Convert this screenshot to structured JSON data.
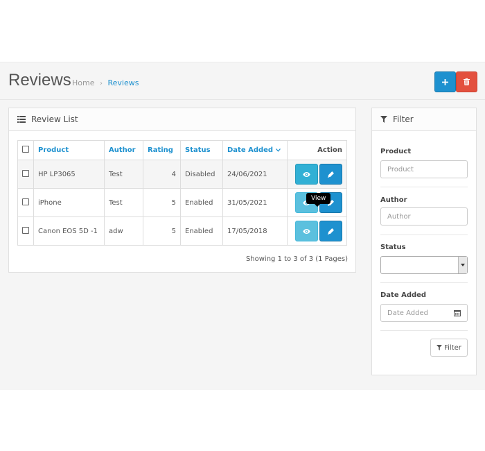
{
  "header": {
    "title": "Reviews",
    "breadcrumb": {
      "home": "Home",
      "separator": "›",
      "current": "Reviews"
    },
    "add_icon": "plus-icon",
    "delete_icon": "trash-icon"
  },
  "list": {
    "heading": "Review List",
    "columns": {
      "product": "Product",
      "author": "Author",
      "rating": "Rating",
      "status": "Status",
      "date_added": "Date Added",
      "action": "Action"
    },
    "rows": [
      {
        "product": "HP LP3065",
        "author": "Test",
        "rating": "4",
        "status": "Disabled",
        "date_added": "24/06/2021"
      },
      {
        "product": "iPhone",
        "author": "Test",
        "rating": "5",
        "status": "Enabled",
        "date_added": "31/05/2021"
      },
      {
        "product": "Canon EOS 5D -1",
        "author": "adw",
        "rating": "5",
        "status": "Enabled",
        "date_added": "17/05/2018"
      }
    ],
    "tooltip": "View",
    "pagination": "Showing 1 to 3 of 3 (1 Pages)"
  },
  "filter": {
    "heading": "Filter",
    "product_label": "Product",
    "product_placeholder": "Product",
    "author_label": "Author",
    "author_placeholder": "Author",
    "status_label": "Status",
    "status_value": "",
    "date_label": "Date Added",
    "date_placeholder": "Date Added",
    "button": "Filter"
  },
  "colors": {
    "primary": "#1e91cf",
    "danger": "#e3503e",
    "info": "#5bc0de"
  }
}
